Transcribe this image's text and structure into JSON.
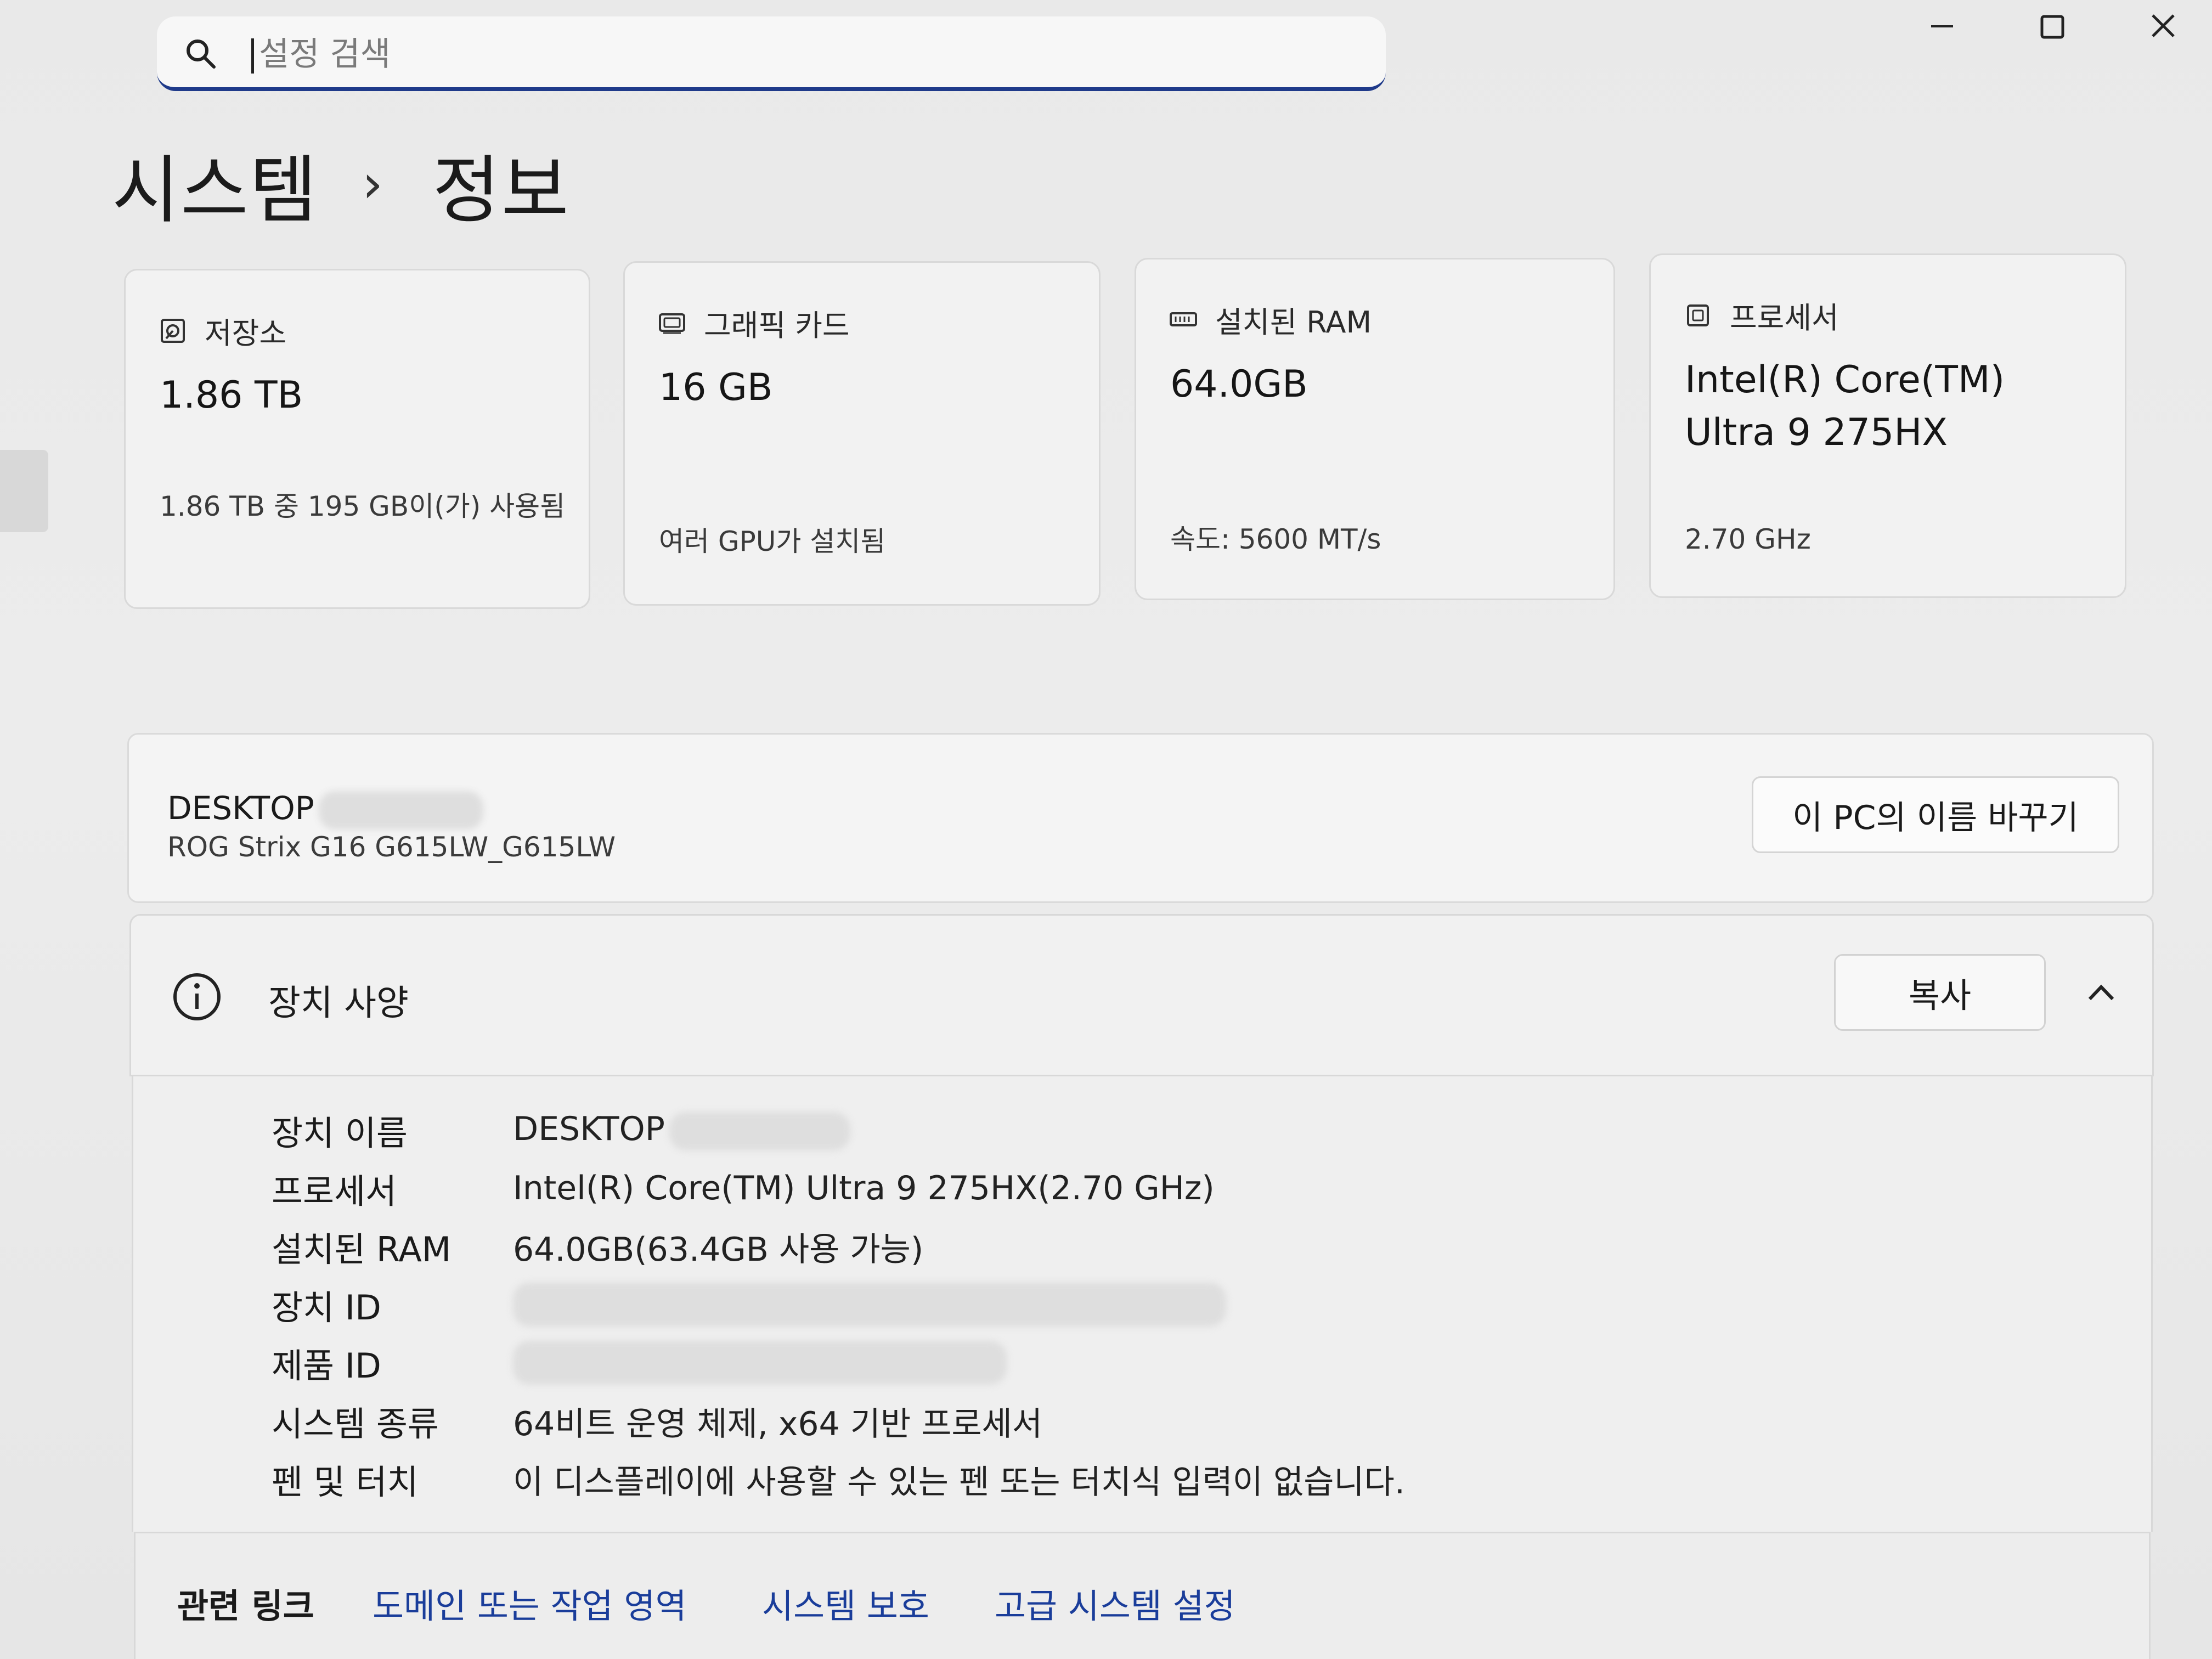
{
  "search": {
    "placeholder": "설정 검색"
  },
  "breadcrumb": {
    "parent": "시스템",
    "separator": "›",
    "current": "정보"
  },
  "cards": [
    {
      "icon": "storage-icon",
      "title": "저장소",
      "value": "1.86 TB",
      "sub": "1.86 TB 중 195 GB이(가) 사용됨"
    },
    {
      "icon": "graphics-card-icon",
      "title": "그래픽 카드",
      "value": "16 GB",
      "sub": "여러 GPU가 설치됨"
    },
    {
      "icon": "ram-icon",
      "title": "설치된 RAM",
      "value": "64.0GB",
      "sub": "속도: 5600 MT/s"
    },
    {
      "icon": "processor-icon",
      "title": "프로세서",
      "value": "Intel(R) Core(TM) Ultra 9 275HX",
      "sub": "2.70 GHz"
    }
  ],
  "device": {
    "name": "DESKTOP",
    "model": "ROG Strix G16 G615LW_G615LW",
    "rename_label": "이 PC의 이름 바꾸기"
  },
  "specs": {
    "title": "장치 사양",
    "copy_label": "복사",
    "rows": [
      {
        "label": "장치 이름",
        "value": "DESKTOP"
      },
      {
        "label": "프로세서",
        "value": "Intel(R) Core(TM) Ultra 9 275HX(2.70 GHz)"
      },
      {
        "label": "설치된 RAM",
        "value": "64.0GB(63.4GB 사용 가능)"
      },
      {
        "label": "장치 ID",
        "value": ""
      },
      {
        "label": "제품 ID",
        "value": ""
      },
      {
        "label": "시스템 종류",
        "value": "64비트 운영 체제, x64 기반 프로세서"
      },
      {
        "label": "펜 및 터치",
        "value": "이 디스플레이에 사용할 수 있는 펜 또는 터치식 입력이 없습니다."
      }
    ]
  },
  "related_links": {
    "label": "관련 링크",
    "links": [
      "도메인 또는 작업 영역",
      "시스템 보호",
      "고급 시스템 설정"
    ]
  }
}
